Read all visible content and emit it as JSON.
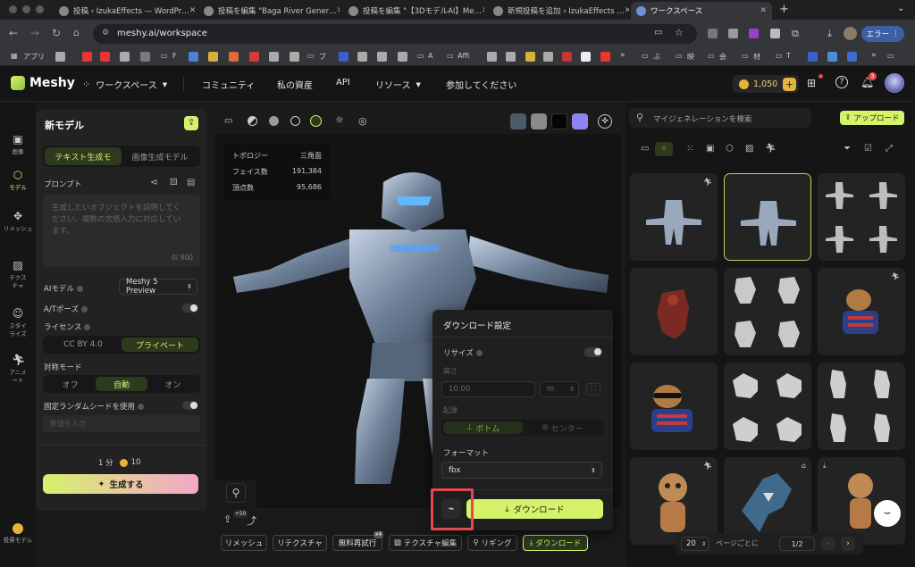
{
  "browser": {
    "tabs": [
      {
        "title": "投稿 ‹ IzukaEffects — WordPr…"
      },
      {
        "title": "投稿を編集 \"Baga River Gener…"
      },
      {
        "title": "投稿を編集 \"【3DモデルAI】Me…"
      },
      {
        "title": "新規投稿を追加 ‹ IzukaEffects …"
      },
      {
        "title": "ワークスペース"
      }
    ],
    "url": "meshy.ai/workspace",
    "error_label": "エラー",
    "bookmarks": [
      {
        "label": "アプリ"
      },
      {
        "label": "F"
      },
      {
        "label": "ブ"
      },
      {
        "label": "A"
      },
      {
        "label": "Affi"
      },
      {
        "label": "ぶ"
      },
      {
        "label": "映"
      },
      {
        "label": "会"
      },
      {
        "label": "材"
      },
      {
        "label": "T"
      }
    ]
  },
  "header": {
    "logo": "Meshy",
    "nav": [
      "ワークスペース",
      "コミュニティ",
      "私の資産",
      "API",
      "リソース",
      "参加してください"
    ],
    "credits": "1,050",
    "notification_count": "3"
  },
  "rail": [
    {
      "label": "画像"
    },
    {
      "label": "モデル"
    },
    {
      "label": "リメッシュ"
    },
    {
      "label": "テクスチャ"
    },
    {
      "label": "スタイライズ"
    },
    {
      "label": "アニメート"
    },
    {
      "label": "投票モデル"
    }
  ],
  "left_panel": {
    "title": "新モデル",
    "tabs": [
      "テキスト生成モ",
      "画像生成モデル"
    ],
    "prompt_label": "プロンプト",
    "prompt_placeholder": "生成したいオブジェクトを説明してください。複数の言語入力に対応しています。",
    "prompt_counter": "0/ 800",
    "ai_model_label": "AIモデル",
    "ai_model_value": "Meshy 5 Preview",
    "apose_label": "A/Tポーズ",
    "license_label": "ライセンス",
    "license_options": [
      "CC BY 4.0",
      "プライベート"
    ],
    "symmetry_label": "対称モード",
    "symmetry_options": [
      "オフ",
      "自動",
      "オン"
    ],
    "seed_label": "固定ランダムシードを使用",
    "seed_placeholder": "数値を入力",
    "time": "1 分",
    "cost": "10",
    "generate": "生成する"
  },
  "viewport": {
    "stats": [
      {
        "k": "トポロジー",
        "v": "三角面"
      },
      {
        "k": "フェイス数",
        "v": "191,384"
      },
      {
        "k": "頂点数",
        "v": "95,686"
      }
    ],
    "bubble": "+50",
    "actions": [
      "リメッシュ",
      "リテクスチャ",
      "無料再試行",
      "テクスチャ編集",
      "リギング",
      "ダウンロード"
    ],
    "retry_badge": "x4"
  },
  "download_panel": {
    "title": "ダウンロード設定",
    "resize_label": "リサイズ",
    "height_label": "高さ",
    "height_value": "10.00",
    "unit": "m",
    "origin_label": "起源",
    "origin_options": [
      "ボトム",
      "センター"
    ],
    "format_label": "フォーマット",
    "format_value": "fbx",
    "download_button": "ダウンロード"
  },
  "gallery": {
    "search_placeholder": "マイジェネレーションを検索",
    "upload": "アップロード",
    "page_size": "20",
    "per_page_label": "ページごとに",
    "page": "1/2"
  },
  "colors": {
    "accent": "#d5f26b",
    "highlight_box": "#e5484d"
  }
}
